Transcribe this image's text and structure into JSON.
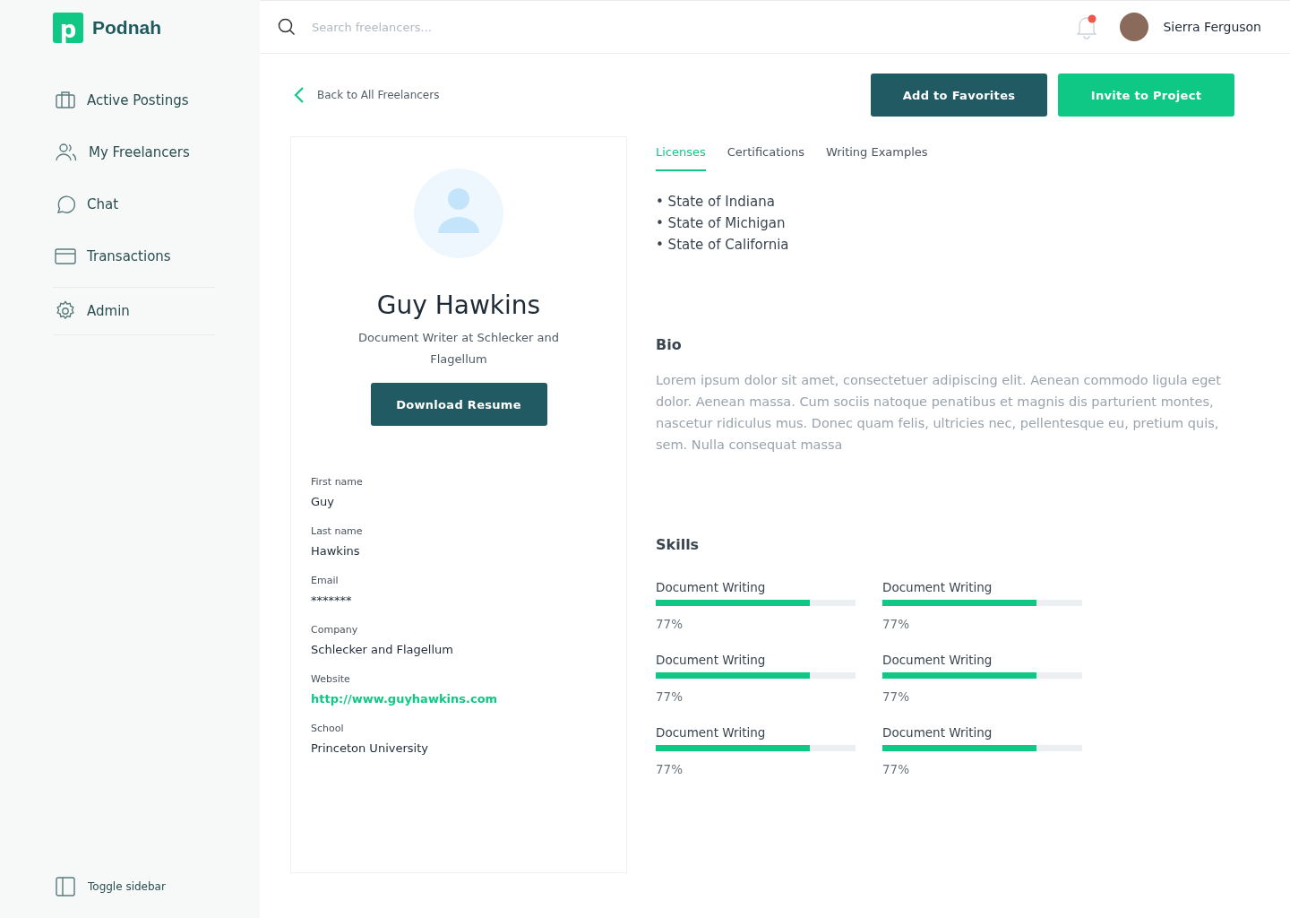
{
  "brand": {
    "name": "Podnah",
    "mark": "p"
  },
  "sidebar": {
    "items": [
      {
        "label": "Active Postings",
        "selected": false
      },
      {
        "label": "My Freelancers",
        "selected": false
      },
      {
        "label": "Chat",
        "selected": false
      },
      {
        "label": "Transactions",
        "selected": false
      }
    ],
    "admin_items": [
      {
        "label": "Admin",
        "selected": false
      }
    ],
    "toggle": "Toggle sidebar"
  },
  "header": {
    "search": {
      "placeholder": "Search freelancers..."
    },
    "notification": true,
    "user": "Sierra Ferguson"
  },
  "back_link": "Back to All Freelancers",
  "actions": [
    "Add to Favorites",
    "Invite to Project"
  ],
  "profile": {
    "name": "Guy Hawkins",
    "subtitle": "Document Writer at Schlecker and Flagellum",
    "button": "Download Resume",
    "fields": [
      {
        "label": "First name",
        "value": "Guy",
        "kind": "text"
      },
      {
        "label": "Last name",
        "value": "Hawkins",
        "kind": "text"
      },
      {
        "label": "Email",
        "value": "*******",
        "kind": "text"
      },
      {
        "label": "Company",
        "value": "Schlecker and Flagellum",
        "kind": "text"
      },
      {
        "label": "Website",
        "value": "http://www.guyhawkins.com",
        "kind": "link"
      },
      {
        "label": "School",
        "value": "Princeton University",
        "kind": "text"
      }
    ]
  },
  "tabs": [
    {
      "label": "Licenses",
      "selected": true
    },
    {
      "label": "Certifications",
      "selected": false
    },
    {
      "label": "Writing Examples",
      "selected": false
    }
  ],
  "licenses": [
    "• State of Indiana",
    "• State of Michigan",
    "• State of California"
  ],
  "bio": {
    "title": "Bio",
    "text": "Lorem ipsum dolor sit amet, consectetuer adipiscing elit. Aenean commodo ligula eget dolor. Aenean massa. Cum sociis natoque penatibus et magnis dis parturient montes, nascetur ridiculus mus. Donec quam felis, ultricies nec, pellentesque eu, pretium quis, sem. Nulla consequat massa"
  },
  "skills": {
    "title": "Skills",
    "items": [
      {
        "name": "Document Writing",
        "level": 0.77,
        "reading": "77%"
      },
      {
        "name": "Document Writing",
        "level": 0.77,
        "reading": "77%"
      },
      {
        "name": "Document Writing",
        "level": 0.77,
        "reading": "77%"
      },
      {
        "name": "Document Writing",
        "level": 0.77,
        "reading": "77%"
      },
      {
        "name": "Document Writing",
        "level": 0.77,
        "reading": "77%"
      },
      {
        "name": "Document Writing",
        "level": 0.77,
        "reading": "77%"
      }
    ]
  }
}
